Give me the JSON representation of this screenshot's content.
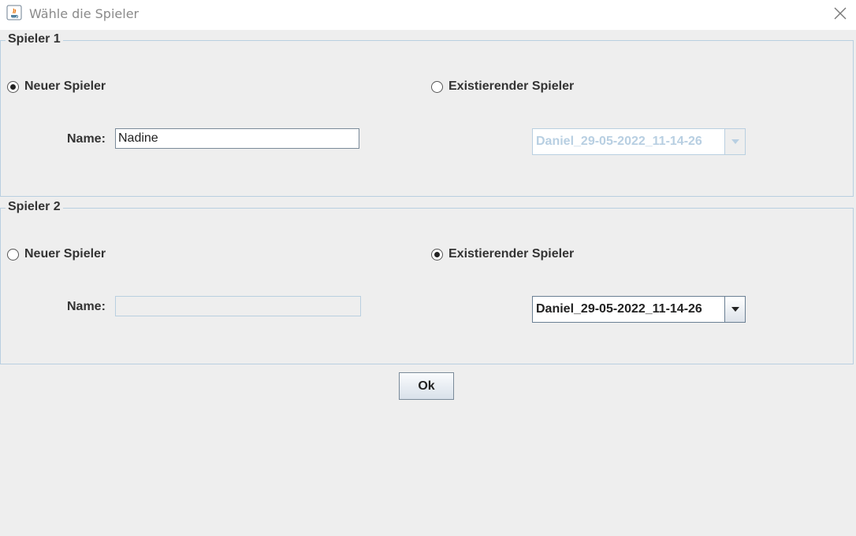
{
  "window": {
    "title": "Wähle die Spieler",
    "icon": "java-cup-icon",
    "close_icon": "close-icon"
  },
  "player1": {
    "legend": "Spieler 1",
    "radio_new_label": "Neuer Spieler",
    "radio_new_selected": true,
    "radio_existing_label": "Existierender Spieler",
    "radio_existing_selected": false,
    "name_label": "Name:",
    "name_value": "Nadine",
    "name_enabled": true,
    "combo_value": "Daniel_29-05-2022_11-14-26",
    "combo_enabled": false
  },
  "player2": {
    "legend": "Spieler 2",
    "radio_new_label": "Neuer Spieler",
    "radio_new_selected": false,
    "radio_existing_label": "Existierender Spieler",
    "radio_existing_selected": true,
    "name_label": "Name:",
    "name_value": "",
    "name_enabled": false,
    "combo_value": "Daniel_29-05-2022_11-14-26",
    "combo_enabled": true
  },
  "ok_button": {
    "label": "Ok"
  },
  "colors": {
    "background": "#eeeeee",
    "border": "#b9cfe0",
    "disabled_text": "#b8cfe2",
    "title_text": "#8a8a8a"
  }
}
